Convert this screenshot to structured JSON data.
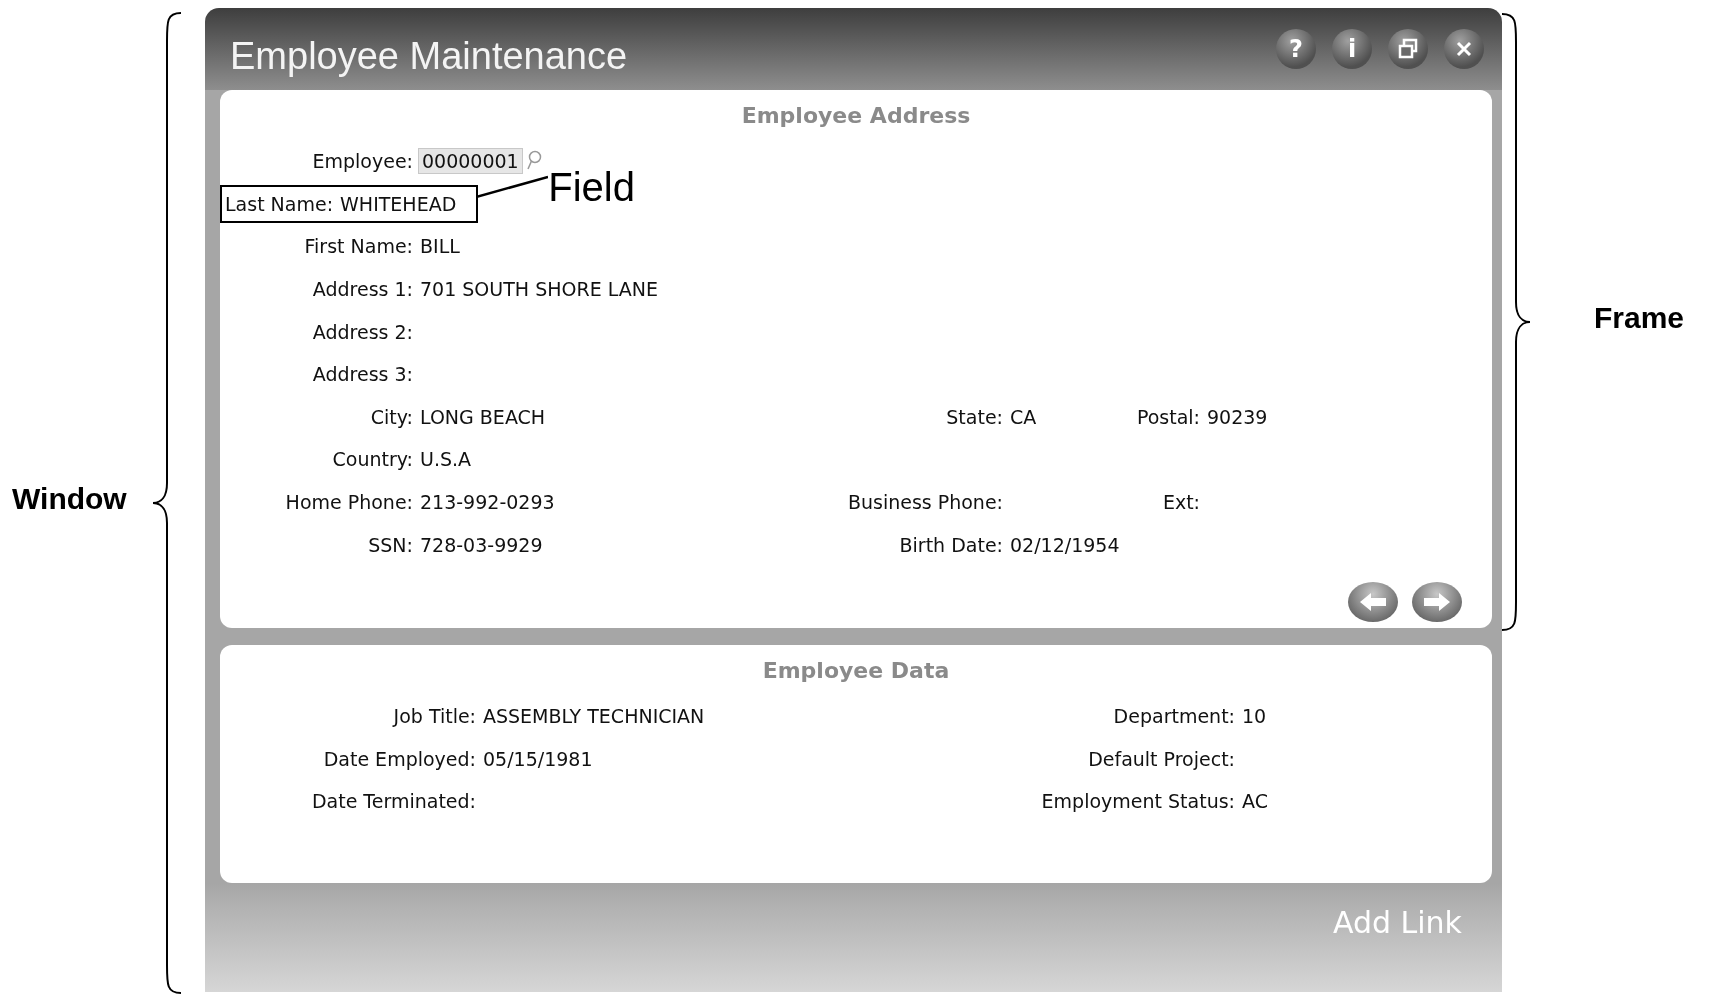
{
  "window": {
    "title": "Employee Maintenance",
    "header_buttons": [
      {
        "kind": "help",
        "glyph": "?"
      },
      {
        "kind": "info",
        "glyph": "i"
      },
      {
        "kind": "restore"
      },
      {
        "kind": "close"
      }
    ]
  },
  "address_panel": {
    "title": "Employee Address",
    "rows": [
      [
        {
          "label": "Employee:",
          "value": "00000001",
          "kind": "lookup"
        }
      ],
      [
        {
          "label": "Last Name:",
          "value": "WHITEHEAD",
          "kind": "text",
          "annotated": true
        }
      ],
      [
        {
          "label": "First Name:",
          "value": "BILL",
          "kind": "text"
        }
      ],
      [
        {
          "label": "Address 1:",
          "value": "701 SOUTH SHORE LANE",
          "kind": "text"
        }
      ],
      [
        {
          "label": "Address 2:",
          "kind": "text"
        }
      ],
      [
        {
          "label": "Address 3:",
          "kind": "text"
        }
      ],
      [
        {
          "label": "City:",
          "value": "LONG BEACH",
          "kind": "text"
        },
        {
          "label": "State:",
          "value": "CA",
          "kind": "text"
        },
        {
          "label": "Postal:",
          "value": "90239",
          "kind": "text"
        }
      ],
      [
        {
          "label": "Country:",
          "value": "U.S.A",
          "kind": "text"
        }
      ],
      [
        {
          "label": "Home Phone:",
          "value": "213-992-0293",
          "kind": "text"
        },
        {
          "label": "Business Phone:",
          "kind": "text"
        },
        {
          "label": "Ext:",
          "kind": "text"
        }
      ],
      [
        {
          "label": "SSN:",
          "value": "728-03-9929",
          "kind": "text"
        },
        {
          "label": "Birth Date:",
          "value": "02/12/1954",
          "kind": "text"
        }
      ]
    ],
    "nav_buttons": [
      {
        "kind": "previous"
      },
      {
        "kind": "next"
      }
    ]
  },
  "data_panel": {
    "title": "Employee Data",
    "rows": [
      [
        {
          "label": "Job Title:",
          "value": "ASSEMBLY TECHNICIAN",
          "kind": "text"
        },
        {
          "label": "Department:",
          "value": "10",
          "kind": "text"
        }
      ],
      [
        {
          "label": "Date Employed:",
          "value": "05/15/1981",
          "kind": "text"
        },
        {
          "label": "Default Project:",
          "kind": "text"
        }
      ],
      [
        {
          "label": "Date Terminated:",
          "kind": "text"
        },
        {
          "label": "Employment Status:",
          "value": "AC",
          "kind": "text"
        }
      ]
    ]
  },
  "footer": {
    "link": "Add Link"
  },
  "annotations": {
    "window_label": "Window",
    "frame_label": "Frame",
    "field_label": "Field"
  }
}
